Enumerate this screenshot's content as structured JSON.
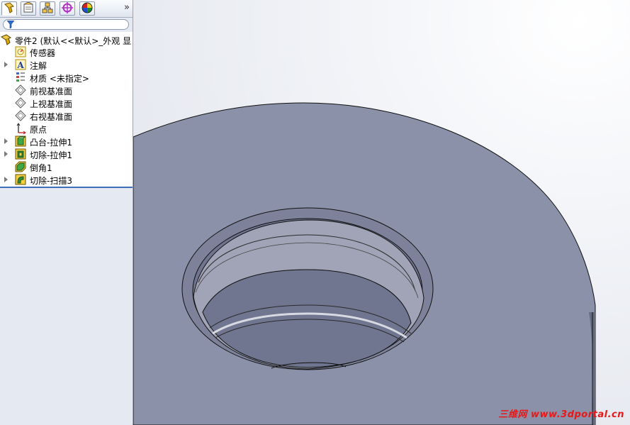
{
  "sidebar": {
    "tabs": [
      {
        "name": "featuremanager-tab",
        "icon": "feature-tree-icon"
      },
      {
        "name": "propertymanager-tab",
        "icon": "property-manager-icon"
      },
      {
        "name": "configurationmanager-tab",
        "icon": "configuration-manager-icon"
      },
      {
        "name": "dimxpert-tab",
        "icon": "dimxpert-icon"
      },
      {
        "name": "appearance-tab",
        "icon": "appearance-icon"
      }
    ],
    "expand_glyph": "»",
    "filter_placeholder": "",
    "tree": {
      "root": "零件2  (默认<<默认>_外观 显",
      "items": [
        {
          "label": "传感器",
          "icon": "sensor-icon",
          "expandable": false
        },
        {
          "label": "注解",
          "icon": "annotation-icon",
          "expandable": true
        },
        {
          "label": "材质 <未指定>",
          "icon": "material-icon",
          "expandable": false
        },
        {
          "label": "前视基准面",
          "icon": "plane-icon",
          "expandable": false
        },
        {
          "label": "上视基准面",
          "icon": "plane-icon",
          "expandable": false
        },
        {
          "label": "右视基准面",
          "icon": "plane-icon",
          "expandable": false
        },
        {
          "label": "原点",
          "icon": "origin-icon",
          "expandable": false
        },
        {
          "label": "凸台-拉伸1",
          "icon": "boss-extrude-icon",
          "expandable": true
        },
        {
          "label": "切除-拉伸1",
          "icon": "cut-extrude-icon",
          "expandable": true
        },
        {
          "label": "倒角1",
          "icon": "chamfer-icon",
          "expandable": false
        },
        {
          "label": "切除-扫描3",
          "icon": "cut-sweep-icon",
          "expandable": true
        }
      ]
    }
  },
  "viewport": {
    "watermark": "三维网 www.3dportal.cn",
    "colors": {
      "part_face": "#8b91a8",
      "hole_wall": "#6b7089",
      "edge": "#111111",
      "background": "#f3f5f9",
      "watermark": "#e81818"
    }
  }
}
